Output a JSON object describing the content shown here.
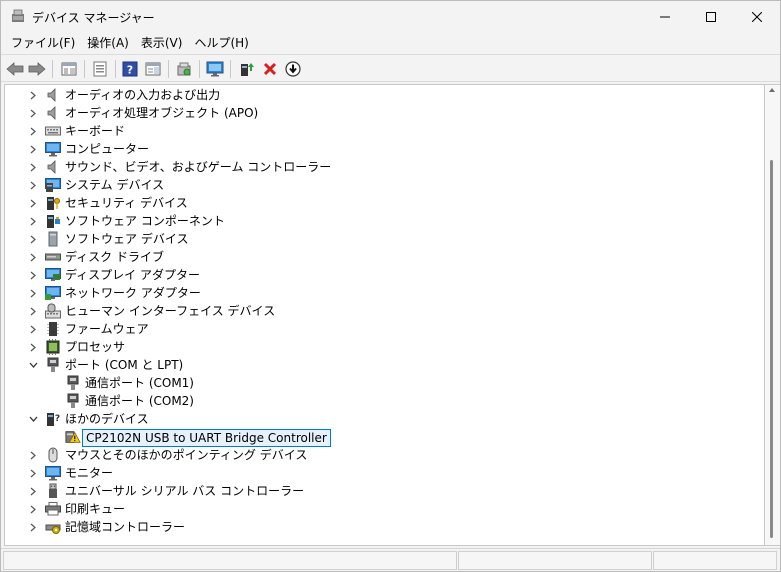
{
  "window": {
    "title": "デバイス マネージャー"
  },
  "menu": [
    {
      "label": "ファイル(F)"
    },
    {
      "label": "操作(A)"
    },
    {
      "label": "表示(V)"
    },
    {
      "label": "ヘルプ(H)"
    }
  ],
  "toolbar_icons": [
    "back-arrow-icon",
    "forward-arrow-icon",
    "show-hide-console-tree-icon",
    "properties-icon",
    "help-icon",
    "action-pane-icon",
    "scan-hardware-icon",
    "monitor-icon",
    "update-driver-icon",
    "uninstall-device-icon",
    "disable-device-icon"
  ],
  "tree": [
    {
      "label": "オーディオの入力および出力",
      "icon": "speaker-icon",
      "level": 0,
      "expander": "collapsed"
    },
    {
      "label": "オーディオ処理オブジェクト (APO)",
      "icon": "speaker-icon",
      "level": 0,
      "expander": "collapsed"
    },
    {
      "label": "キーボード",
      "icon": "keyboard-icon",
      "level": 0,
      "expander": "collapsed"
    },
    {
      "label": "コンピューター",
      "icon": "computer-icon",
      "level": 0,
      "expander": "collapsed"
    },
    {
      "label": "サウンド、ビデオ、およびゲーム コントローラー",
      "icon": "speaker-icon",
      "level": 0,
      "expander": "collapsed"
    },
    {
      "label": "システム デバイス",
      "icon": "system-device-icon",
      "level": 0,
      "expander": "collapsed"
    },
    {
      "label": "セキュリティ デバイス",
      "icon": "security-key-icon",
      "level": 0,
      "expander": "collapsed"
    },
    {
      "label": "ソフトウェア コンポーネント",
      "icon": "software-component-icon",
      "level": 0,
      "expander": "collapsed"
    },
    {
      "label": "ソフトウェア デバイス",
      "icon": "software-device-icon",
      "level": 0,
      "expander": "collapsed"
    },
    {
      "label": "ディスク ドライブ",
      "icon": "disk-drive-icon",
      "level": 0,
      "expander": "collapsed"
    },
    {
      "label": "ディスプレイ アダプター",
      "icon": "display-adapter-icon",
      "level": 0,
      "expander": "collapsed"
    },
    {
      "label": "ネットワーク アダプター",
      "icon": "network-adapter-icon",
      "level": 0,
      "expander": "collapsed"
    },
    {
      "label": "ヒューマン インターフェイス デバイス",
      "icon": "hid-icon",
      "level": 0,
      "expander": "collapsed"
    },
    {
      "label": "ファームウェア",
      "icon": "firmware-icon",
      "level": 0,
      "expander": "collapsed"
    },
    {
      "label": "プロセッサ",
      "icon": "processor-icon",
      "level": 0,
      "expander": "collapsed"
    },
    {
      "label": "ポート (COM と LPT)",
      "icon": "port-icon",
      "level": 0,
      "expander": "expanded"
    },
    {
      "label": "通信ポート (COM1)",
      "icon": "port-icon",
      "level": 1,
      "expander": "none"
    },
    {
      "label": "通信ポート (COM2)",
      "icon": "port-icon",
      "level": 1,
      "expander": "none"
    },
    {
      "label": "ほかのデバイス",
      "icon": "other-device-icon",
      "level": 0,
      "expander": "expanded"
    },
    {
      "label": "CP2102N USB to UART Bridge Controller",
      "icon": "warning-device-icon",
      "level": 1,
      "expander": "none",
      "selected": true
    },
    {
      "label": "マウスとそのほかのポインティング デバイス",
      "icon": "mouse-icon",
      "level": 0,
      "expander": "collapsed"
    },
    {
      "label": "モニター",
      "icon": "monitor-icon",
      "level": 0,
      "expander": "collapsed"
    },
    {
      "label": "ユニバーサル シリアル バス コントローラー",
      "icon": "usb-icon",
      "level": 0,
      "expander": "collapsed"
    },
    {
      "label": "印刷キュー",
      "icon": "printer-icon",
      "level": 0,
      "expander": "collapsed"
    },
    {
      "label": "記憶域コントローラー",
      "icon": "storage-controller-icon",
      "level": 0,
      "expander": "collapsed"
    }
  ],
  "colors": {
    "accent": "#0078d4",
    "selection_bg": "#e5f1fb",
    "warning": "#f2c811",
    "delete_red": "#d81e1e"
  }
}
